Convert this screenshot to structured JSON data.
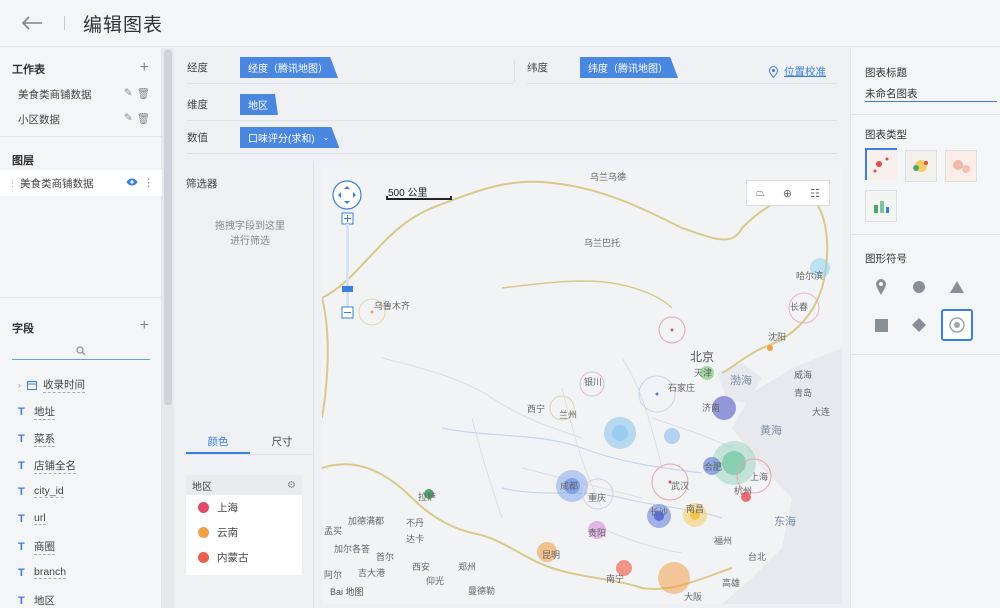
{
  "header": {
    "title": "编辑图表"
  },
  "left": {
    "workspace_title": "工作表",
    "workspace_items": [
      {
        "label": "美食类商铺数据"
      },
      {
        "label": "小区数据"
      }
    ],
    "layers_title": "图层",
    "layer_item": "美食类商铺数据",
    "fields_title": "字段",
    "fields": [
      {
        "label": "收录时间",
        "type": "date"
      },
      {
        "label": "地址",
        "type": "T"
      },
      {
        "label": "菜系",
        "type": "T"
      },
      {
        "label": "店铺全名",
        "type": "T"
      },
      {
        "label": "city_id",
        "type": "T"
      },
      {
        "label": "url",
        "type": "T"
      },
      {
        "label": "商圈",
        "type": "T"
      },
      {
        "label": "branch",
        "type": "T"
      },
      {
        "label": "地区",
        "type": "T"
      }
    ]
  },
  "shelves": {
    "lng_label": "经度",
    "lng_value": "经度（腾讯地图）",
    "lat_label": "纬度",
    "lat_value": "纬度（腾讯地图）",
    "locate_link": "位置校准",
    "dim_label": "维度",
    "dim_value": "地区",
    "val_label": "数值",
    "val_value": "口味评分(求和)"
  },
  "filter": {
    "title": "筛选器",
    "hint_line1": "拖拽字段到这里",
    "hint_line2": "进行筛选",
    "tab_color": "颜色",
    "tab_size": "尺寸",
    "legend_title": "地区",
    "legend": [
      {
        "label": "上海",
        "color": "#e24a6a"
      },
      {
        "label": "云南",
        "color": "#f2a04a"
      },
      {
        "label": "内蒙古",
        "color": "#e8604e"
      }
    ]
  },
  "map": {
    "scale_label": "500 公里",
    "cities": [
      "乌兰乌德",
      "乌兰巴托",
      "乌鲁木齐",
      "哈尔滨",
      "长春",
      "沈阳",
      "北京",
      "天津",
      "石家庄",
      "银川",
      "西宁",
      "兰州",
      "济南",
      "威海",
      "青岛",
      "大连",
      "黄海",
      "渤海",
      "成都",
      "重庆",
      "武汉",
      "合肥",
      "上海",
      "杭州",
      "东海",
      "长沙",
      "南昌",
      "福州",
      "台北",
      "高雄",
      "南宁",
      "贵阳",
      "昆明",
      "加德满都",
      "不丹",
      "阿尔",
      "吉大港",
      "达卡",
      "曼德勒",
      "仰光",
      "孟买",
      "加尔各答",
      "拉萨",
      "西安",
      "郑州",
      "大阪",
      "首尔"
    ],
    "attribution": "Bai 地图"
  },
  "right": {
    "chart_title_label": "图表标题",
    "chart_title_value": "未命名图表",
    "chart_type_label": "图表类型",
    "symbol_label": "图形符号"
  }
}
